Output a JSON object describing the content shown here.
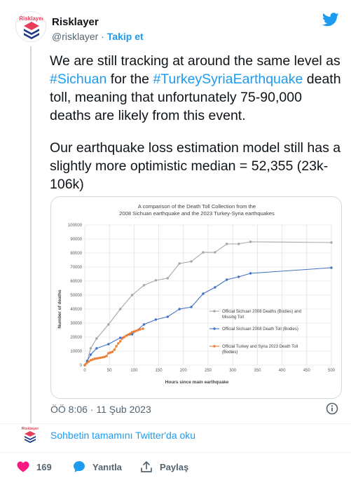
{
  "author": {
    "name": "Risklayer",
    "handle": "@risklayer",
    "separator": "·",
    "follow_label": "Takip et",
    "logo_text": "Risklayer"
  },
  "tweet": {
    "p1_prefix": "We are still tracking at around the same level as ",
    "p1_tag1": "#Sichuan",
    "p1_mid": " for the ",
    "p1_tag2": "#TurkeySyriaEarthquake",
    "p1_suffix": " death toll, meaning that unfortunately 75-90,000 deaths are likely from this event.",
    "p2": "Our earthquake loss estimation model still has a slightly more optimistic median = 52,355 (23k-106k)",
    "timestamp": "ÖÖ 8:06 · 11 Şub 2023"
  },
  "footer": {
    "read_more": "Sohbetin tamamını Twitter'da oku",
    "likes": "169",
    "reply_label": "Yanıtla",
    "share_label": "Paylaş"
  },
  "colors": {
    "accent": "#1d9bf0",
    "like": "#f91880",
    "gray_series": "#a6a6a6",
    "blue_series": "#4472c4",
    "orange_series": "#ed7d31"
  },
  "chart_data": {
    "type": "line",
    "title_line1": "A comparison of the Death Toll Collection from the",
    "title_line2": "2008 Sichuan earthquake and the 2023 Turkey-Syria earthquakes",
    "xlabel": "Hours since main earthquake",
    "ylabel": "Number of deaths",
    "xlim": [
      0,
      500
    ],
    "ylim": [
      0,
      100000
    ],
    "x_ticks": [
      "0",
      "50",
      "100",
      "150",
      "200",
      "250",
      "300",
      "350",
      "400",
      "450",
      "500"
    ],
    "y_ticks": [
      "0",
      "10000",
      "20000",
      "30000",
      "40000",
      "50000",
      "60000",
      "70000",
      "80000",
      "90000",
      "100000"
    ],
    "grid": true,
    "legend_position": "right",
    "series": [
      {
        "name": "Official Sichuan 2008 Deaths (Bodies) and Missing Toll",
        "color": "#a6a6a6",
        "points": [
          [
            0,
            0
          ],
          [
            5,
            3000
          ],
          [
            12,
            12000
          ],
          [
            24,
            19000
          ],
          [
            48,
            29000
          ],
          [
            72,
            40000
          ],
          [
            96,
            50000
          ],
          [
            120,
            57000
          ],
          [
            144,
            60500
          ],
          [
            168,
            62000
          ],
          [
            192,
            72500
          ],
          [
            216,
            74000
          ],
          [
            240,
            80500
          ],
          [
            264,
            80500
          ],
          [
            288,
            86500
          ],
          [
            312,
            86500
          ],
          [
            336,
            88000
          ],
          [
            500,
            87500
          ]
        ]
      },
      {
        "name": "Official Sichuan 2008 Death Toll (Bodies)",
        "color": "#4472c4",
        "points": [
          [
            0,
            0
          ],
          [
            5,
            3000
          ],
          [
            12,
            7500
          ],
          [
            24,
            12000
          ],
          [
            48,
            15000
          ],
          [
            72,
            19500
          ],
          [
            96,
            22000
          ],
          [
            120,
            29000
          ],
          [
            144,
            32500
          ],
          [
            168,
            34500
          ],
          [
            192,
            40000
          ],
          [
            216,
            41500
          ],
          [
            240,
            51000
          ],
          [
            264,
            55500
          ],
          [
            288,
            61000
          ],
          [
            312,
            63000
          ],
          [
            336,
            65500
          ],
          [
            500,
            69500
          ]
        ]
      },
      {
        "name": "Official Turkey and Syria 2023 Death Toll (Bodies)",
        "color": "#ed7d31",
        "points": [
          [
            0,
            0
          ],
          [
            4,
            1500
          ],
          [
            8,
            2500
          ],
          [
            12,
            3500
          ],
          [
            16,
            4000
          ],
          [
            20,
            4500
          ],
          [
            24,
            4800
          ],
          [
            28,
            5000
          ],
          [
            32,
            5300
          ],
          [
            36,
            5600
          ],
          [
            40,
            5900
          ],
          [
            44,
            6500
          ],
          [
            48,
            8500
          ],
          [
            52,
            9000
          ],
          [
            56,
            9500
          ],
          [
            60,
            11000
          ],
          [
            64,
            13500
          ],
          [
            68,
            15500
          ],
          [
            72,
            17000
          ],
          [
            76,
            19000
          ],
          [
            80,
            20000
          ],
          [
            84,
            21000
          ],
          [
            88,
            21800
          ],
          [
            92,
            22500
          ],
          [
            96,
            23500
          ],
          [
            100,
            24000
          ],
          [
            104,
            24500
          ],
          [
            108,
            25000
          ],
          [
            112,
            25500
          ],
          [
            118,
            26000
          ]
        ]
      }
    ]
  }
}
